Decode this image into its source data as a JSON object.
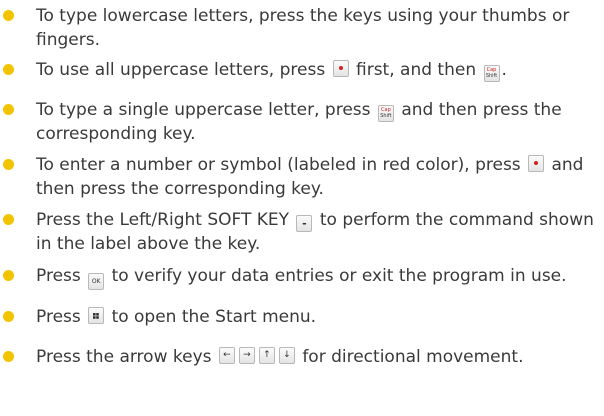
{
  "items": [
    {
      "text_a": "To type lowercase letters, press the keys using your thumbs or fingers."
    },
    {
      "text_a": "To use all uppercase letters, press",
      "text_b": "first, and then",
      "text_c": "."
    },
    {
      "text_a": "To type a single uppercase letter, press",
      "text_b": "and then press the corresponding key."
    },
    {
      "text_a": "To enter a number or symbol (labeled in red color), press",
      "text_b": "and then press the corresponding key."
    },
    {
      "text_a": "Press the Left/Right SOFT KEY",
      "text_b": "to perform the command shown in the label above the key."
    },
    {
      "text_a": "Press",
      "text_b": "to verify your data entries or exit the program in use."
    },
    {
      "text_a": "Press",
      "text_b": "to open the Start menu."
    },
    {
      "text_a": "Press the arrow keys",
      "text_b": "for directional movement."
    }
  ],
  "keys": {
    "cap_shift": {
      "top": "Cap",
      "bottom": "Shift"
    },
    "soft_key": "-",
    "ok": "OK",
    "arrows": [
      "←",
      "→",
      "↑",
      "↓"
    ]
  },
  "colors": {
    "bullet": "#f2c400",
    "symbol_red": "#d32020",
    "text": "#3a3a3a"
  },
  "icons": [
    "bullet-dot-icon",
    "function-key-icon",
    "cap-shift-key-icon",
    "soft-key-icon",
    "ok-key-icon",
    "start-key-icon",
    "arrow-left-key-icon",
    "arrow-right-key-icon",
    "arrow-up-key-icon",
    "arrow-down-key-icon"
  ]
}
